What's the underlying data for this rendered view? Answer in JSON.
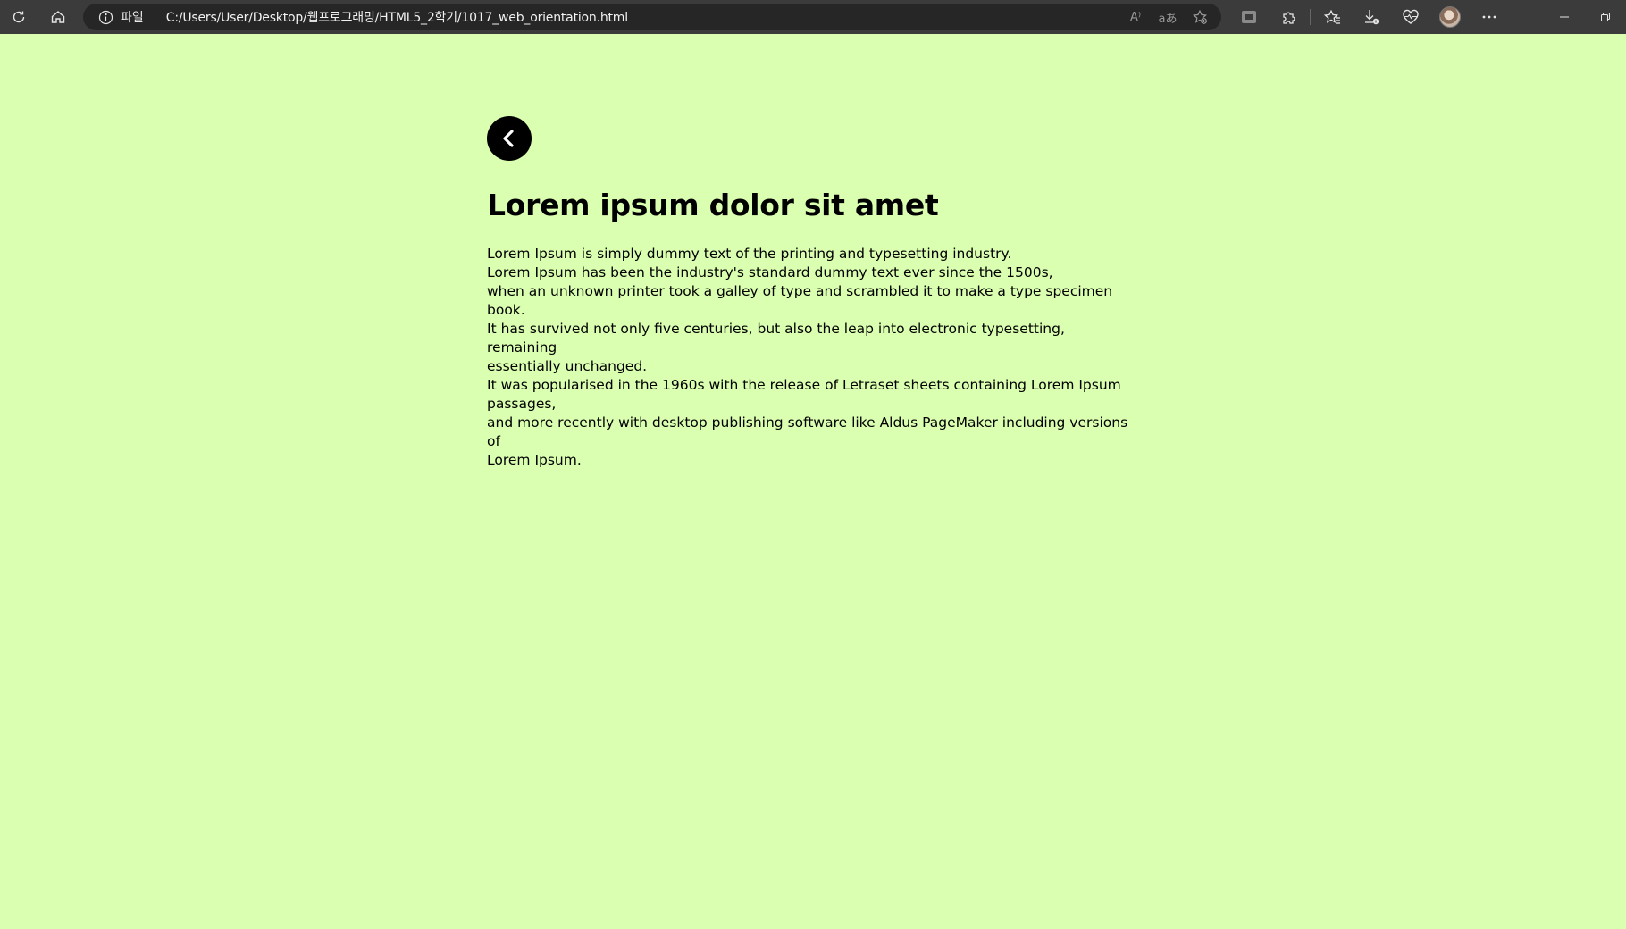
{
  "browser": {
    "site_info_label": "파일",
    "url": "C:/Users/User/Desktop/웹프로그래밍/HTML5_2학기/1017_web_orientation.html",
    "read_aloud_label": "A⁾",
    "translate_label": "aあ",
    "icons": {
      "refresh": "refresh-icon",
      "home": "home-icon",
      "info": "info-icon",
      "read_aloud": "read-aloud-icon",
      "translate": "translate-icon",
      "favorite_add": "favorite-add-icon",
      "extension_ex": "extension-ex-icon",
      "extensions": "puzzle-icon",
      "favorites": "favorites-icon",
      "downloads": "download-icon",
      "health": "heart-icon",
      "profile": "avatar",
      "more": "more-icon",
      "minimize": "minimize-icon",
      "restore": "restore-icon"
    }
  },
  "page": {
    "background": "#dbffb1",
    "back_icon": "chevron-left-icon",
    "title": "Lorem ipsum dolor sit amet",
    "paragraph_lines": [
      "Lorem Ipsum is simply dummy text of the printing and typesetting industry.",
      "Lorem Ipsum has been the industry's standard dummy text ever since the 1500s,",
      "when an unknown printer took a galley of type and scrambled it to make a type specimen book.",
      "It has survived not only five centuries, but also the leap into electronic typesetting, remaining",
      "essentially unchanged.",
      "It was popularised in the 1960s with the release of Letraset sheets containing Lorem Ipsum",
      "passages,",
      "and more recently with desktop publishing software like Aldus PageMaker including versions of",
      "Lorem Ipsum."
    ]
  }
}
